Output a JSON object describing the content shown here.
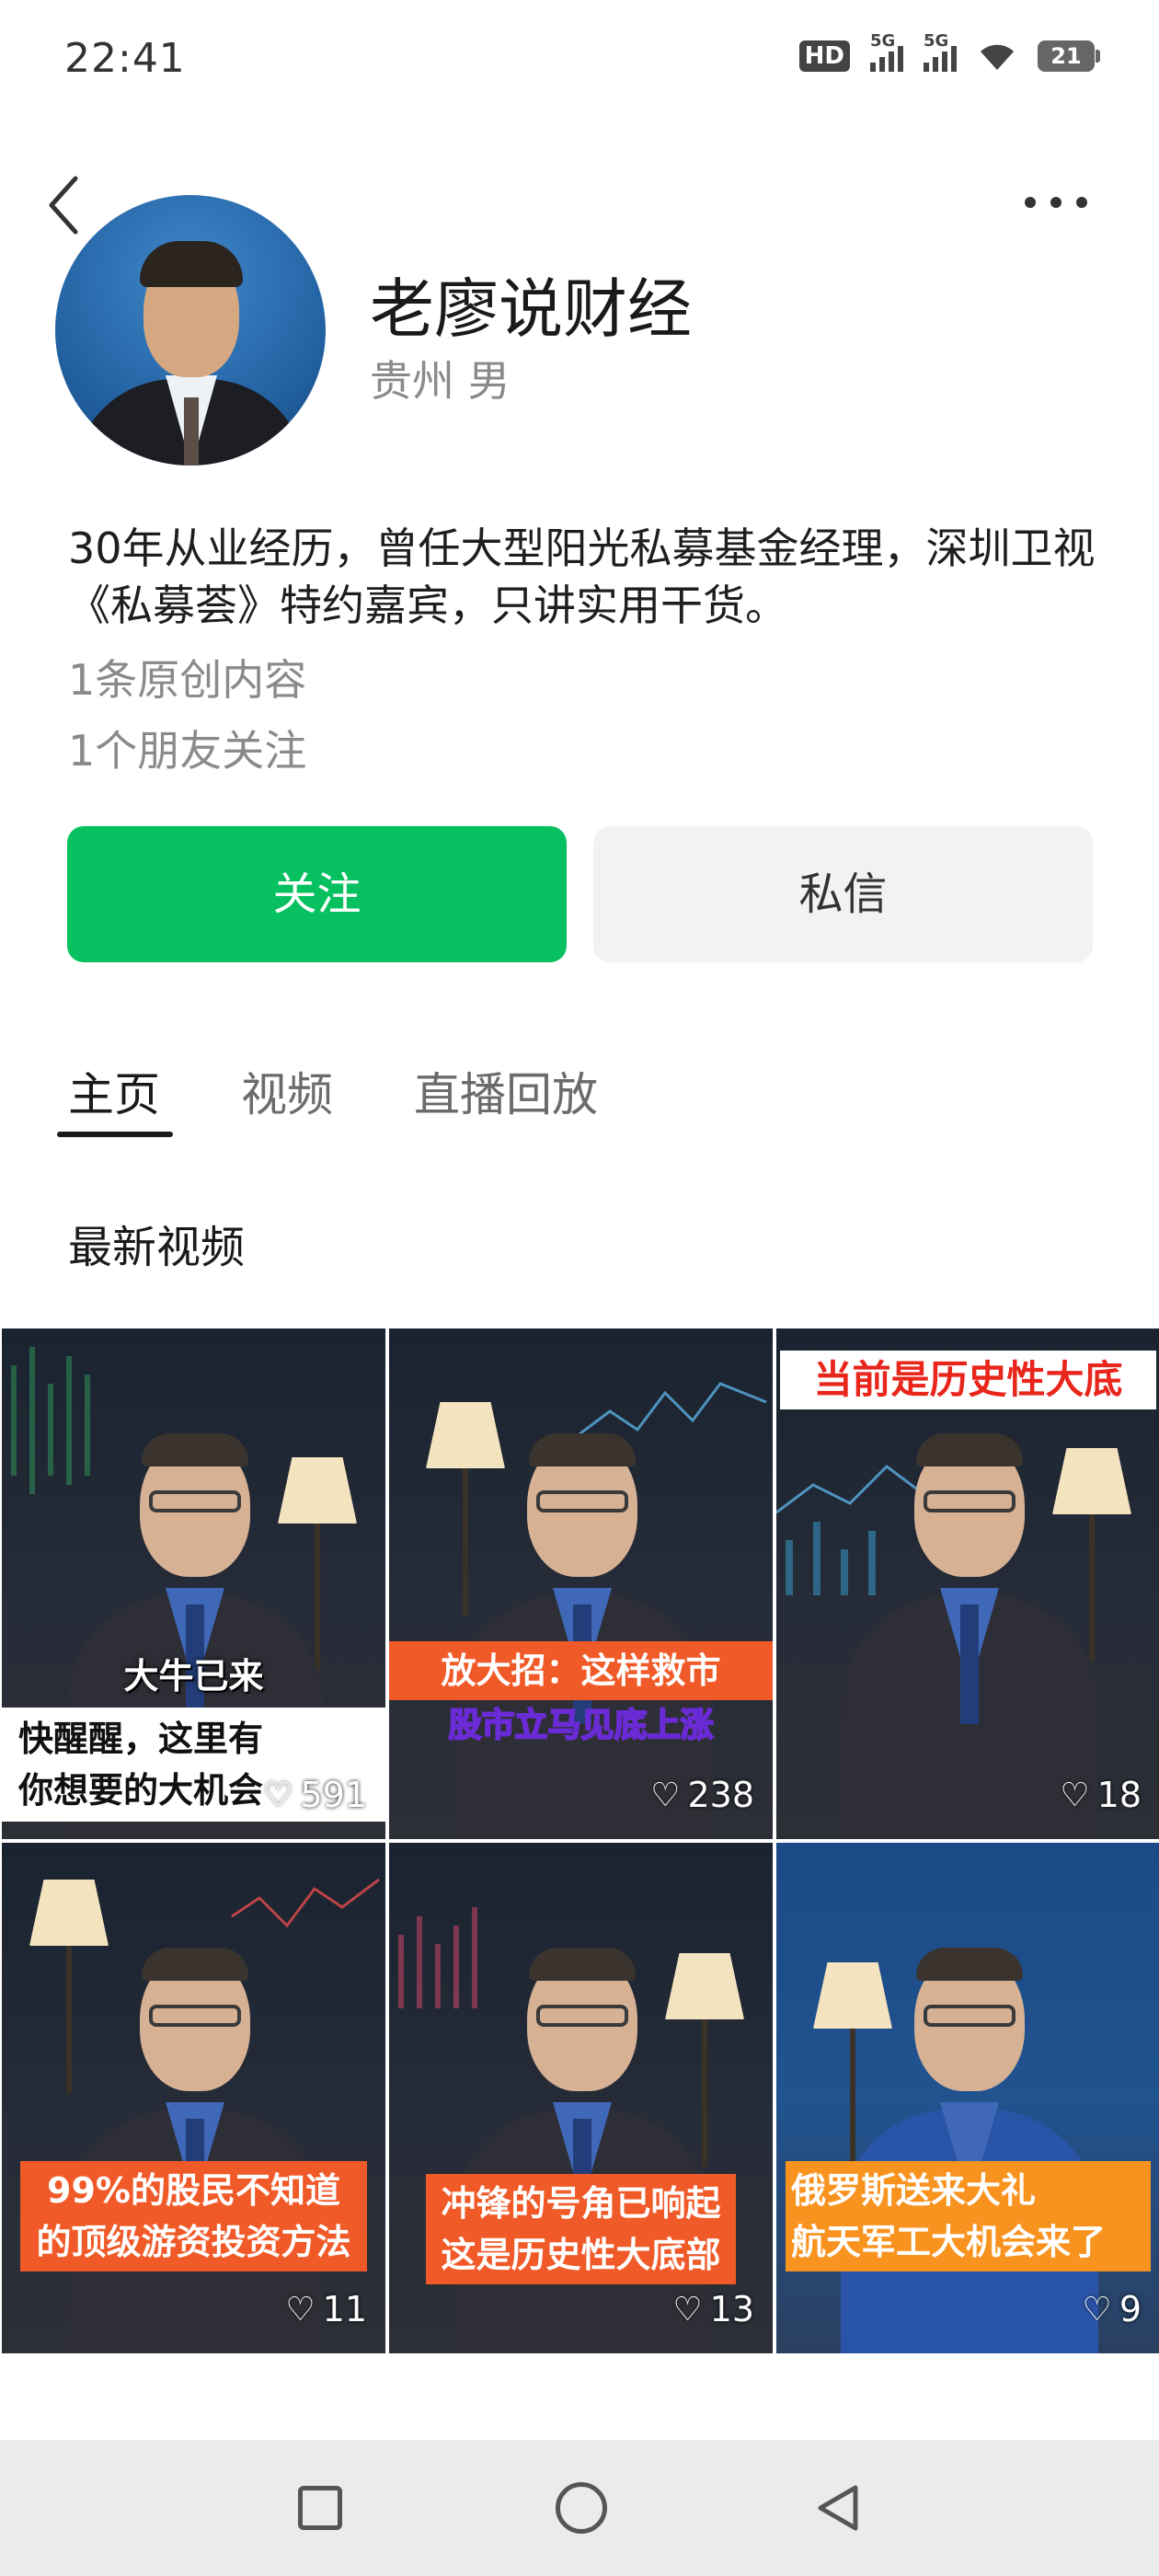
{
  "status_bar": {
    "time": "22:41",
    "hd": "HD",
    "signal1": "5G",
    "signal2": "5G",
    "battery": "21"
  },
  "profile": {
    "name": "老廖说财经",
    "sub_info": "贵州 男",
    "bio": "30年从业经历，曾任大型阳光私募基金经理，深圳卫视《私募荟》特约嘉宾，只讲实用干货。",
    "original_count": "1条原创内容",
    "friends_following": "1个朋友关注"
  },
  "actions": {
    "follow_label": "关注",
    "message_label": "私信"
  },
  "tabs": [
    {
      "label": "主页",
      "active": true
    },
    {
      "label": "视频",
      "active": false
    },
    {
      "label": "直播回放",
      "active": false
    }
  ],
  "section_title": "最新视频",
  "videos": [
    {
      "caption_top": "大牛已来",
      "caption_box": "快醒醒，这里有\n你想要的大机会",
      "likes": "591"
    },
    {
      "caption_top": "放大招：这样救市",
      "caption_sub": "股市立马见底上涨",
      "likes": "238"
    },
    {
      "caption_top": "当前是历史性大底",
      "likes": "18"
    },
    {
      "caption_top": "99%的股民不知道\n的顶级游资投资方法",
      "likes": "11"
    },
    {
      "caption_top": "冲锋的号角已响起\n这是历史性大底部",
      "likes": "13"
    },
    {
      "caption_top": "俄罗斯送来大礼\n航天军工大机会来了",
      "likes": "9"
    }
  ],
  "icons": {
    "back": "chevron-left-icon",
    "more": "more-dots-icon",
    "like": "heart-icon"
  },
  "colors": {
    "accent": "#07c160",
    "caption_orange": "#f05a28"
  }
}
